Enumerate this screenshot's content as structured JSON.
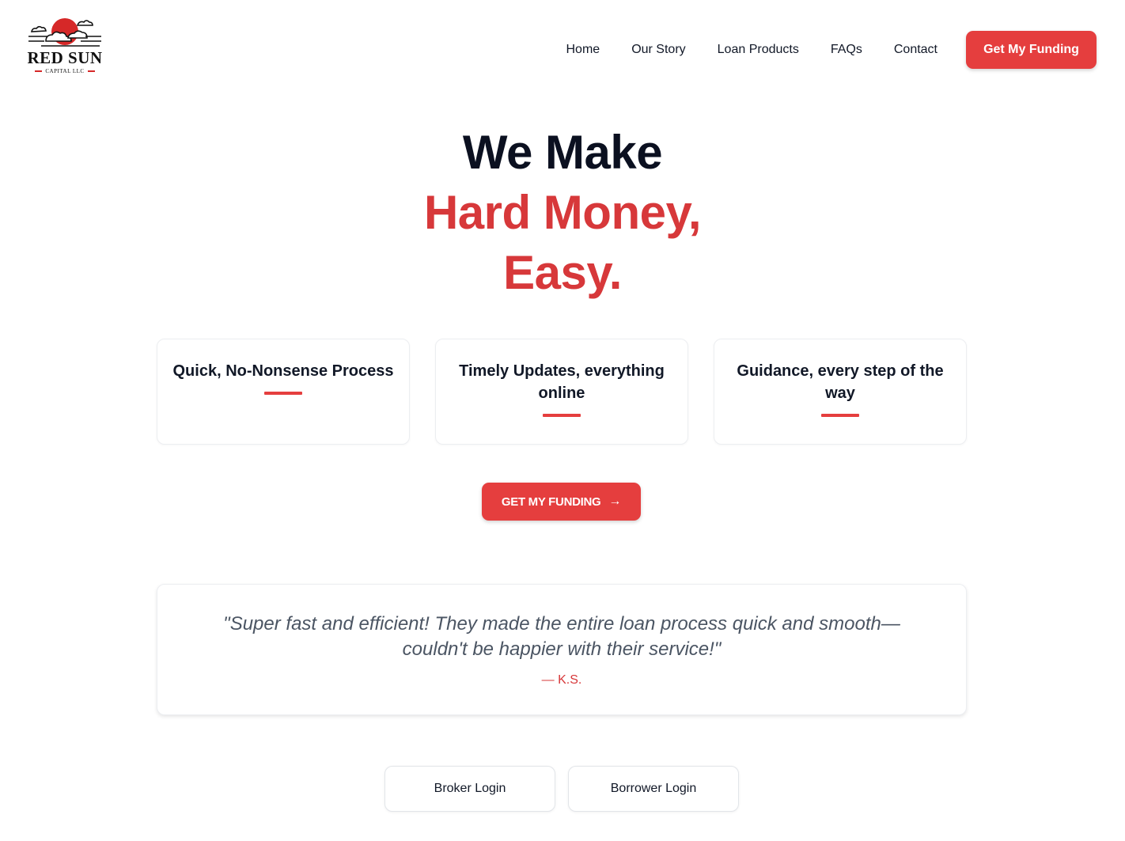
{
  "brand": {
    "name": "RED SUN",
    "subtitle": "CAPITAL LLC",
    "logo_icon": "red-sun-clouds-logo",
    "accent_color": "#e53e3e"
  },
  "nav": {
    "links": [
      "Home",
      "Our Story",
      "Loan Products",
      "FAQs",
      "Contact"
    ],
    "cta_label": "Get My Funding"
  },
  "hero": {
    "line1": "We Make",
    "line2": "Hard Money,",
    "line3": "Easy."
  },
  "features": [
    {
      "title": "Quick, No-Nonsense Process"
    },
    {
      "title": "Timely Updates, everything online"
    },
    {
      "title": "Guidance, every step of the way"
    }
  ],
  "cta": {
    "label": "GET MY FUNDING",
    "icon": "arrow-right-icon"
  },
  "testimonial": {
    "quote": "\"Super fast and efficient! They made the entire loan process quick and smooth—couldn't be happier with their service!\"",
    "author": "— K.S."
  },
  "logins": {
    "broker_label": "Broker Login",
    "borrower_label": "Borrower Login"
  }
}
